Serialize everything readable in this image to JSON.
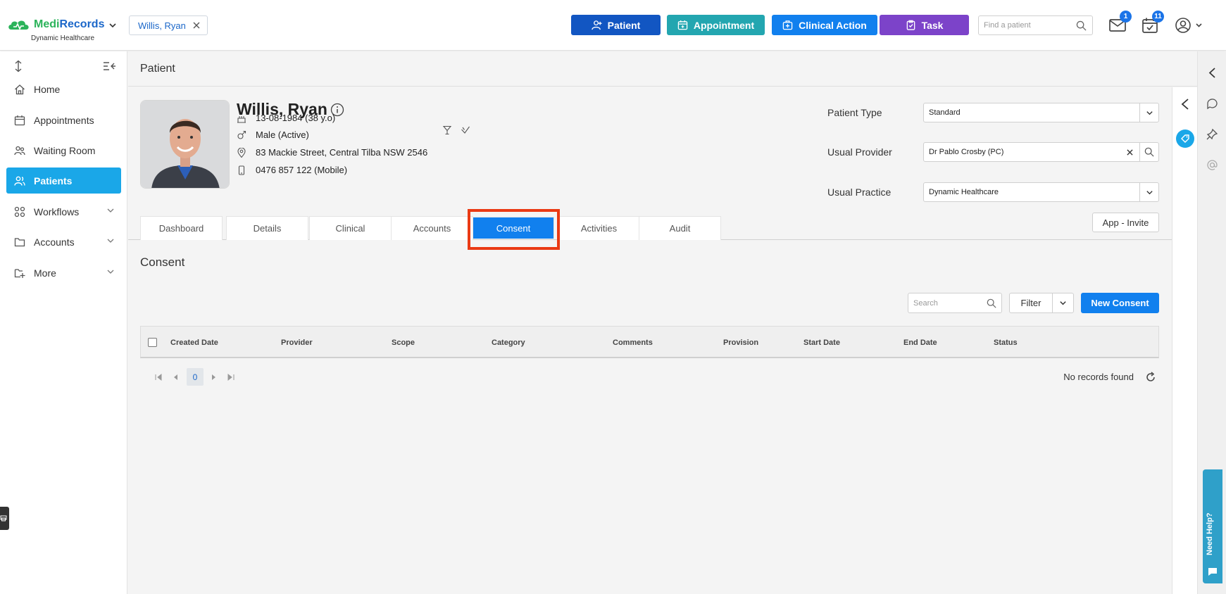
{
  "brand": {
    "name_part1": "Medi",
    "name_part2": "Records",
    "sub": "Dynamic Healthcare"
  },
  "header": {
    "patient_chip": "Willis, Ryan",
    "buttons": {
      "patient": "Patient",
      "appointment": "Appointment",
      "clinical_action": "Clinical Action",
      "task": "Task"
    },
    "find_placeholder": "Find a patient",
    "mail_badge": "1",
    "tasks_badge": "11"
  },
  "sidebar": {
    "items": [
      {
        "label": "Home",
        "icon": "home-icon"
      },
      {
        "label": "Appointments",
        "icon": "calendar-icon"
      },
      {
        "label": "Waiting Room",
        "icon": "people-icon"
      },
      {
        "label": "Patients",
        "icon": "patients-icon"
      },
      {
        "label": "Workflows",
        "icon": "workflow-icon"
      },
      {
        "label": "Accounts",
        "icon": "folder-icon"
      },
      {
        "label": "More",
        "icon": "more-folder-icon"
      }
    ]
  },
  "page": {
    "title": "Patient"
  },
  "patient": {
    "name": "Willis, Ryan",
    "dob": "13-08-1984 (38 y.o)",
    "gender": "Male (Active)",
    "address": "83 Mackie Street, Central Tilba NSW 2546",
    "phone": "0476 857 122 (Mobile)",
    "fields": {
      "patient_type_label": "Patient Type",
      "patient_type": "Standard",
      "usual_provider_label": "Usual Provider",
      "usual_provider": "Dr Pablo Crosby (PC)",
      "usual_practice_label": "Usual Practice",
      "usual_practice": "Dynamic Healthcare"
    },
    "app_invite": "App - Invite"
  },
  "tabs": [
    "Dashboard",
    "Details",
    "Clinical",
    "Accounts",
    "Consent",
    "Activities",
    "Audit"
  ],
  "consent": {
    "title": "Consent",
    "search_placeholder": "Search",
    "filter_label": "Filter",
    "new_label": "New Consent",
    "columns": [
      "Created Date",
      "Provider",
      "Scope",
      "Category",
      "Comments",
      "Provision",
      "Start Date",
      "End Date",
      "Status"
    ],
    "page_number": "0",
    "no_records": "No records found"
  },
  "help": {
    "label": "Need Help?"
  }
}
